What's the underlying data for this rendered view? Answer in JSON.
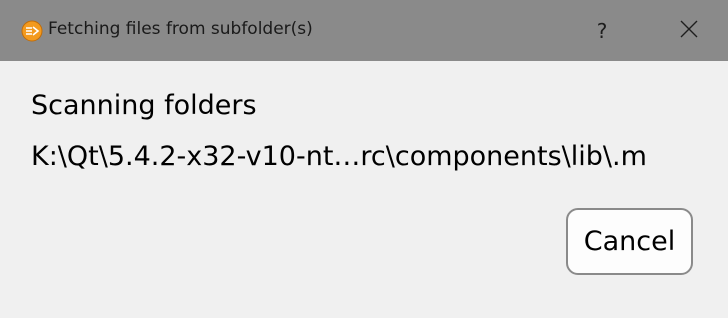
{
  "window": {
    "title": "Fetching files from subfolder(s)",
    "help_label": "?",
    "icon": "app-logo-icon",
    "close_icon": "close-icon"
  },
  "content": {
    "status_text": "Scanning folders",
    "path_text": "K:\\Qt\\5.4.2-x32-v10-nt…rc\\components\\lib\\.m"
  },
  "buttons": {
    "cancel_label": "Cancel"
  },
  "colors": {
    "titlebar": "#8a8a8a",
    "background": "#f0f0f0",
    "icon_orange": "#f39a1e",
    "button_border": "#8a8a8a"
  }
}
